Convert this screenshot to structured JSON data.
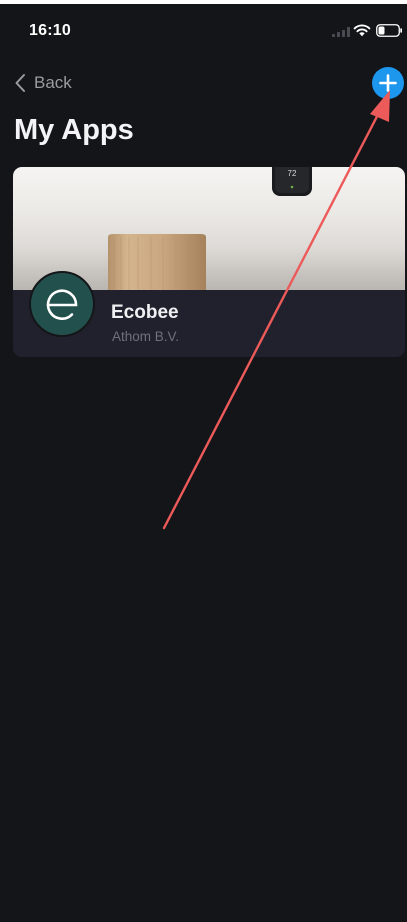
{
  "status_bar": {
    "time": "16:10"
  },
  "nav": {
    "back_label": "Back",
    "add_icon": "plus-icon"
  },
  "page": {
    "title": "My Apps"
  },
  "apps": [
    {
      "name": "Ecobee",
      "author": "Athom B.V.",
      "logo_letter": "e",
      "photo_thermostat_reading": "72"
    }
  ],
  "colors": {
    "background": "#141519",
    "card": "#20212c",
    "accent": "#1d96ee",
    "logo_bg": "#22504c",
    "annotation": "#ec5a5a"
  }
}
